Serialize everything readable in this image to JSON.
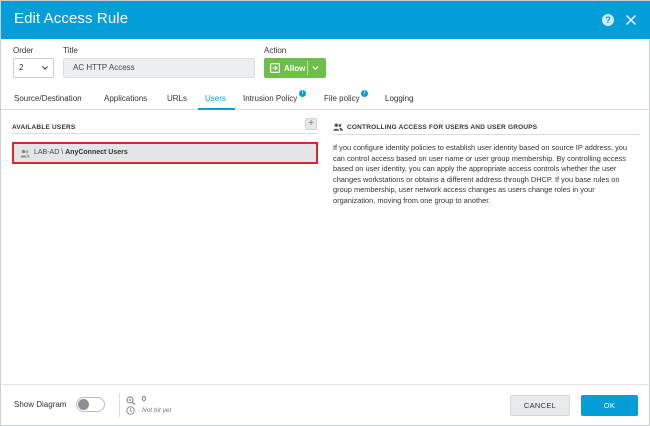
{
  "dialog": {
    "title": "Edit Access Rule",
    "help_icon": "help-icon",
    "close_icon": "close-icon"
  },
  "form": {
    "order_label": "Order",
    "order_value": "2",
    "title_label": "Title",
    "title_value": "AC HTTP Access",
    "action_label": "Action",
    "action_value": "Allow"
  },
  "tabs": [
    {
      "label": "Source/Destination",
      "active": false
    },
    {
      "label": "Applications",
      "active": false
    },
    {
      "label": "URLs",
      "active": false
    },
    {
      "label": "Users",
      "active": true
    },
    {
      "label": "Intrusion Policy",
      "active": false,
      "info": true
    },
    {
      "label": "File policy",
      "active": false,
      "info": true
    },
    {
      "label": "Logging",
      "active": false
    }
  ],
  "available_users": {
    "heading": "AVAILABLE USERS",
    "add_symbol": "+",
    "items": [
      {
        "prefix": "LAB-AD \\ ",
        "name": "AnyConnect Users"
      }
    ]
  },
  "help_panel": {
    "heading": "CONTROLLING ACCESS FOR USERS AND USER GROUPS",
    "body": "If you configure identity policies to establish user identity based on source IP address, you can control access based on user name or user group membership. By controlling access based on user identity, you can apply the appropriate access controls whether the user changes workstations or obtains a different address through DHCP. If you base rules on group membership, user network access changes as users change roles in your organization, moving from one group to another."
  },
  "footer": {
    "show_diagram_label": "Show Diagram",
    "show_diagram_on": false,
    "hit_count": "0",
    "hit_status": "Not hit yet",
    "cancel_label": "CANCEL",
    "ok_label": "OK"
  },
  "colors": {
    "header": "#049fd9",
    "allow": "#6cc04a",
    "highlight_border": "#d9262f",
    "primary": "#049fd9"
  }
}
